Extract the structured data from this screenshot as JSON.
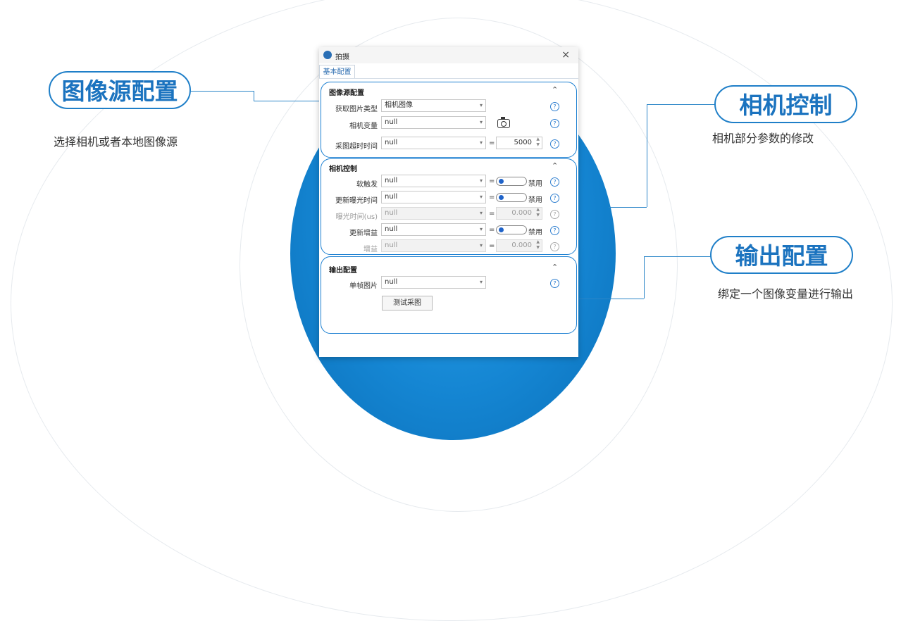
{
  "callouts": {
    "source": {
      "label": "图像源配置",
      "caption": "选择相机或者本地图像源"
    },
    "camera": {
      "label": "相机控制",
      "caption": "相机部分参数的修改"
    },
    "output": {
      "label": "输出配置",
      "caption": "绑定一个图像变量进行输出"
    }
  },
  "dialog": {
    "title": "拍摄",
    "close_icon": "×",
    "tab": "基本配置",
    "sections": {
      "source": {
        "title": "图像源配置",
        "rows": {
          "type": {
            "label": "获取图片类型",
            "value": "相机图像"
          },
          "var": {
            "label": "相机变量",
            "value": "null"
          },
          "timeout": {
            "label": "采图超时时间",
            "value": "null",
            "eq": "=",
            "number": "5000"
          }
        }
      },
      "camera": {
        "title": "相机控制",
        "rows": {
          "soft": {
            "label": "软触发",
            "value": "null",
            "eq": "=",
            "toggle": "禁用"
          },
          "upd_exp": {
            "label": "更新曝光时间",
            "value": "null",
            "eq": "=",
            "toggle": "禁用"
          },
          "exposure": {
            "label": "曝光时间(us)",
            "value": "null",
            "eq": "=",
            "number": "0.000"
          },
          "upd_gain": {
            "label": "更新增益",
            "value": "null",
            "eq": "=",
            "toggle": "禁用"
          },
          "gain": {
            "label": "增益",
            "value": "null",
            "eq": "=",
            "number": "0.000"
          }
        }
      },
      "output": {
        "title": "输出配置",
        "rows": {
          "frame": {
            "label": "单帧图片",
            "value": "null"
          }
        },
        "test_button": "测试采图"
      }
    },
    "help_glyph": "?",
    "collapse_glyph": "⌃",
    "dropdown_glyph": "▾",
    "spin_up": "▲",
    "spin_down": "▼"
  },
  "colors": {
    "accent": "#1b73bf",
    "circle": "#1586d3",
    "line": "#2c86c8"
  }
}
